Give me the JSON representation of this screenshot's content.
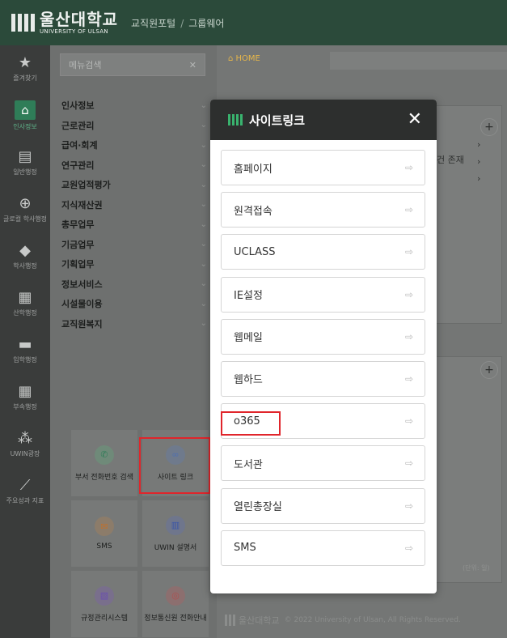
{
  "header": {
    "logo_ko": "울산대학교",
    "logo_en": "UNIVERSITY OF ULSAN",
    "crumb_1": "교직원포털",
    "crumb_sep": "/",
    "crumb_2": "그룹웨어"
  },
  "rail": [
    {
      "label": "즐겨찾기",
      "icon": "star-icon",
      "glyph": "★"
    },
    {
      "label": "인사정보",
      "icon": "home-icon",
      "glyph": "⌂",
      "active": true
    },
    {
      "label": "일반행정",
      "icon": "clipboard-icon",
      "glyph": "▤"
    },
    {
      "label": "글로컬 학사행정",
      "icon": "globe-icon",
      "glyph": "⊕"
    },
    {
      "label": "학사행정",
      "icon": "graduation-cap-icon",
      "glyph": "◆"
    },
    {
      "label": "산학행정",
      "icon": "building-icon",
      "glyph": "▦"
    },
    {
      "label": "입학행정",
      "icon": "id-card-icon",
      "glyph": "▬"
    },
    {
      "label": "부속행정",
      "icon": "grid-icon",
      "glyph": "▦"
    },
    {
      "label": "UWIN광장",
      "icon": "people-icon",
      "glyph": "⁂"
    },
    {
      "label": "주요성과 지표",
      "icon": "chart-line-icon",
      "glyph": "⟋"
    }
  ],
  "menu": {
    "search_placeholder": "메뉴검색",
    "items": [
      "인사정보",
      "근로관리",
      "급여·회계",
      "연구관리",
      "교원업적평가",
      "지식재산권",
      "총무업무",
      "기금업무",
      "기획업무",
      "정보서비스",
      "시설물이용",
      "교직원복지"
    ]
  },
  "tiles": [
    {
      "label": "부서 전화번호 검색",
      "icon": "phone-icon",
      "glyph": "✆"
    },
    {
      "label": "사이트 링크",
      "icon": "link-icon",
      "glyph": "∞"
    },
    {
      "label": "SMS",
      "icon": "mail-icon",
      "glyph": "✉"
    },
    {
      "label": "UWIN 설명서",
      "icon": "book-icon",
      "glyph": "▥"
    },
    {
      "label": "규정관리시스템",
      "icon": "document-icon",
      "glyph": "▧"
    },
    {
      "label": "정보통신원 전화안내",
      "icon": "headset-icon",
      "glyph": "◎"
    }
  ],
  "main": {
    "home_label": "HOME",
    "ghost_text": "건 존재",
    "unit_label": "(단위: 일)",
    "footer_logo": "울산대학교",
    "footer_text": "© 2022 University of Ulsan, All Rights Reserved."
  },
  "modal": {
    "title": "사이트링크",
    "links": [
      "홈페이지",
      "원격접속",
      "UCLASS",
      "IE설정",
      "웹메일",
      "웹하드",
      "o365",
      "도서관",
      "열린총장실",
      "SMS"
    ]
  },
  "colors": {
    "header_bg": "#2b4a3a",
    "accent_green": "#39b36e",
    "highlight_red": "#e0252b"
  }
}
